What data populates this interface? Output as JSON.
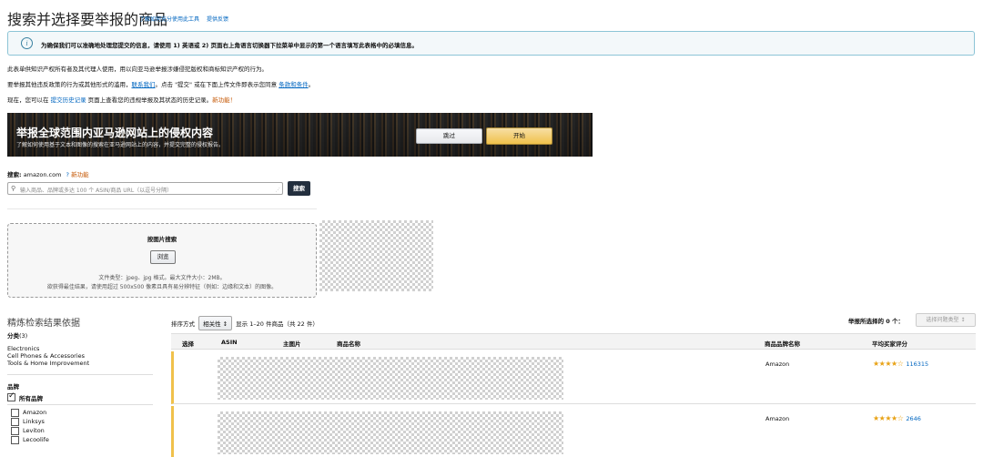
{
  "header": {
    "title": "搜索并选择要举报的商品",
    "links": [
      "了解如何充分使用此工具",
      "提供反馈"
    ]
  },
  "info": {
    "text": "为确保我们可以准确地处理您提交的信息，请使用 1) 英语或 2) 页面右上角语言切换器下拉菜单中显示的第一个语言填写此表格中的必填信息。"
  },
  "intro": {
    "line1": "此表单供知识产权所有者及其代理人使用，用以向亚马逊举报涉嫌侵犯版权和商标知识产权的行为。",
    "line2_pre": "要举报其他违反政策的行为或其他形式的滥用，",
    "line2_link": "联系我们",
    "line2_mid": "。点击 \"提交\" 或在下面上传文件即表示您同意 ",
    "line2_link2": "条款和条件",
    "line2_end": "。",
    "line3_pre": "现在，您可以在 ",
    "line3_link": "提交历史记录",
    "line3_mid": " 页面上查看您的违规举报及其状态的历史记录。",
    "line3_new": "新功能！"
  },
  "banner": {
    "title": "举报全球范围内亚马逊网站上的侵权内容",
    "subtitle": "了解如何使用基于文本和图像的搜索在亚马逊网站上的内容，并提交完整的侵权报告。",
    "skip_label": "跳过",
    "start_label": "开始"
  },
  "search": {
    "label_prefix": "搜索:",
    "domain": "amazon.com",
    "help": "?",
    "new_badge": "新功能",
    "placeholder": "输入商品、品牌或多达 100 个 ASIN/商品 URL（以逗号分隔）",
    "button_label": "搜索"
  },
  "image_search": {
    "title": "按图片搜索",
    "browse_label": "浏览",
    "note1": "文件类型：jpeg、jpg 格式。最大文件大小：2MB。",
    "note2": "欲获得最佳结果，请使用超过 500x500 像素且具有易分辨特征（例如：边缘和文本）的图像。"
  },
  "refine": {
    "title": "精炼检索结果依据",
    "category_label": "分类",
    "category_count": "(3)",
    "categories": [
      "Electronics",
      "Cell Phones & Accessories",
      "Tools & Home Improvement"
    ],
    "brand_label": "品牌",
    "all_brands": "所有品牌",
    "brands": [
      "Amazon",
      "Linksys",
      "Leviton",
      "Lecoolife"
    ]
  },
  "results": {
    "sort_label": "排序方式",
    "sort_value": "相关性 ↕",
    "showing": "显示 1–20 件商品（共 22 件）",
    "report_count": "举报所选择的 0 个：",
    "selected_btn": "选择问题类型 ↕",
    "headers": [
      "选择",
      "ASIN",
      "主图片",
      "商品名称",
      "商品品牌名称",
      "平均买家评分"
    ],
    "rows": [
      {
        "brand": "Amazon",
        "stars": "★★★★☆",
        "reviews": "116315"
      },
      {
        "brand": "Amazon",
        "stars": "★★★★☆",
        "reviews": "2646"
      }
    ]
  }
}
